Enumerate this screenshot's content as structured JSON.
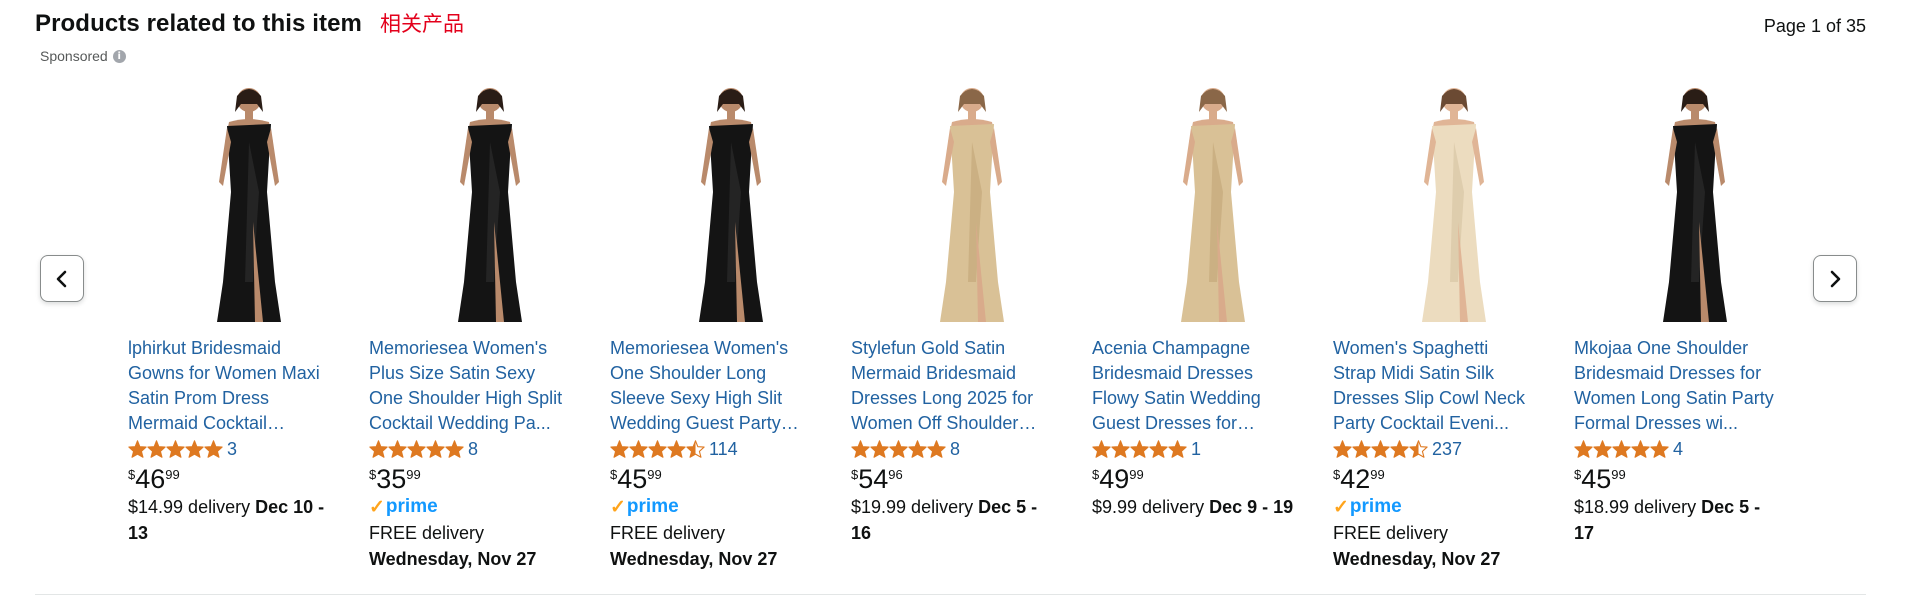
{
  "header": {
    "title": "Products related to this item",
    "annotation": "相关产品",
    "page_indicator": "Page 1 of 35",
    "sponsored": "Sponsored"
  },
  "colors": {
    "link": "#2162a1",
    "star": "#de7921",
    "prime_blue": "#1399ff",
    "prime_check": "#ffa41c",
    "annotation_red": "#e3001b"
  },
  "nav": {
    "prev_icon": "chevron-left-icon",
    "next_icon": "chevron-right-icon"
  },
  "products": [
    {
      "title": "lphirkut Bridesmaid Gowns for Women Maxi Satin Prom Dress Mermaid Cocktail…",
      "rating": 5,
      "reviews": "3",
      "price_symbol": "$",
      "price_whole": "46",
      "price_fraction": "99",
      "prime": false,
      "delivery_text": "$14.99 delivery ",
      "delivery_date": "Dec 10 - 13",
      "dress_color": "black"
    },
    {
      "title": "Memoriesea Women's Plus Size Satin Sexy One Shoulder High Split Cocktail Wedding Pa...",
      "rating": 5,
      "reviews": "8",
      "price_symbol": "$",
      "price_whole": "35",
      "price_fraction": "99",
      "prime": true,
      "delivery_text": "FREE delivery",
      "delivery_date": "Wednesday, Nov 27",
      "dress_color": "black"
    },
    {
      "title": "Memoriesea Women's One Shoulder Long Sleeve Sexy High Slit Wedding Guest Party…",
      "rating": 4.5,
      "reviews": "114",
      "price_symbol": "$",
      "price_whole": "45",
      "price_fraction": "99",
      "prime": true,
      "delivery_text": "FREE delivery",
      "delivery_date": "Wednesday, Nov 27",
      "dress_color": "black"
    },
    {
      "title": "Stylefun Gold Satin Mermaid Bridesmaid Dresses Long 2025 for Women Off Shoulder…",
      "rating": 5,
      "reviews": "8",
      "price_symbol": "$",
      "price_whole": "54",
      "price_fraction": "96",
      "prime": false,
      "delivery_text": "$19.99 delivery ",
      "delivery_date": "Dec 5 - 16",
      "dress_color": "champagne"
    },
    {
      "title": "Acenia Champagne Bridesmaid Dresses Flowy Satin Wedding Guest Dresses for…",
      "rating": 5,
      "reviews": "1",
      "price_symbol": "$",
      "price_whole": "49",
      "price_fraction": "99",
      "prime": false,
      "delivery_text": "$9.99 delivery ",
      "delivery_date": "Dec 9 - 19",
      "dress_color": "champagne"
    },
    {
      "title": "Women's Spaghetti Strap Midi Satin Silk Dresses Slip Cowl Neck Party Cocktail Eveni...",
      "rating": 4.5,
      "reviews": "237",
      "price_symbol": "$",
      "price_whole": "42",
      "price_fraction": "99",
      "prime": true,
      "delivery_text": "FREE delivery",
      "delivery_date": "Wednesday, Nov 27",
      "dress_color": "ivory"
    },
    {
      "title": "Mkojaa One Shoulder Bridesmaid Dresses for Women Long Satin Party Formal Dresses wi...",
      "rating": 5,
      "reviews": "4",
      "price_symbol": "$",
      "price_whole": "45",
      "price_fraction": "99",
      "prime": false,
      "delivery_text": "$18.99 delivery ",
      "delivery_date": "Dec 5 - 17",
      "dress_color": "black"
    }
  ],
  "prime_label": "prime"
}
